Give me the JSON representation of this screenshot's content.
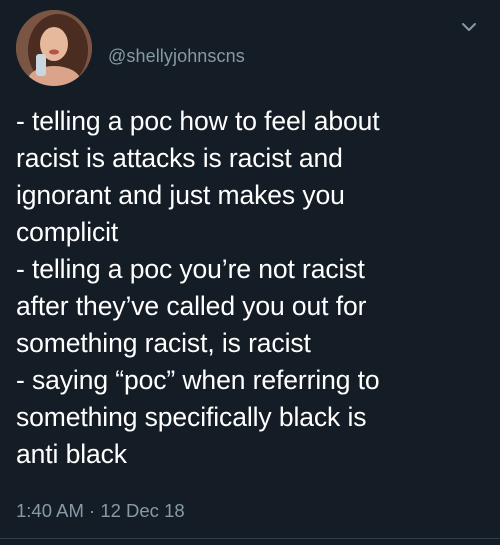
{
  "tweet": {
    "handle": "@shellyjohnscns",
    "text": "- telling a poc how to feel about\nracist is attacks is racist and\nignorant and just makes you\ncomplicit\n- telling a poc you’re not racist\nafter they’ve called you out for\nsomething racist, is racist\n- saying “poc” when referring to\nsomething specifically black is\nanti black",
    "timestamp": "1:40 AM · 12 Dec 18"
  },
  "icons": {
    "menu": "chevron-down-icon",
    "avatar": "profile-photo"
  },
  "colors": {
    "background": "#141d26",
    "text": "#ffffff",
    "muted": "#8899a6"
  }
}
